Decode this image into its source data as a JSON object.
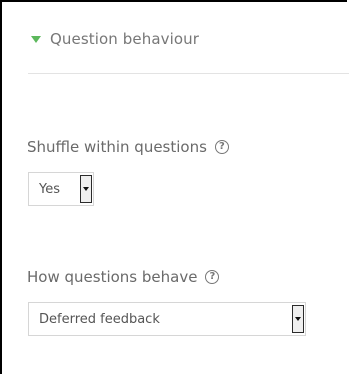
{
  "section": {
    "title": "Question behaviour",
    "toggle_icon": "triangle-down-icon",
    "toggle_color": "#5cb85c"
  },
  "fields": {
    "shuffle": {
      "label": "Shuffle within questions",
      "help_icon": "help-icon",
      "value": "Yes"
    },
    "behaviour": {
      "label": "How questions behave",
      "help_icon": "help-icon",
      "value": "Deferred feedback"
    }
  },
  "help_glyph": "?"
}
